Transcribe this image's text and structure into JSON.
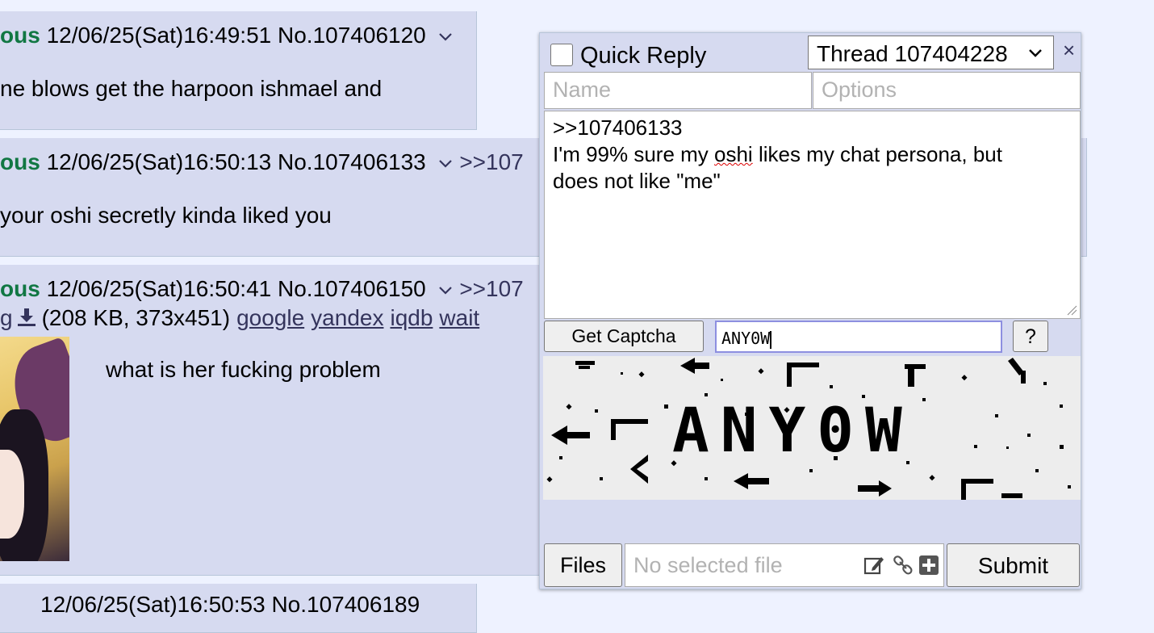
{
  "posts": [
    {
      "name": "ous",
      "datetime": "12/06/25(Sat)16:49:51",
      "number": "No.107406120",
      "backlink": "",
      "message": "ne blows get the harpoon ishmael and"
    },
    {
      "name": "ous",
      "datetime": "12/06/25(Sat)16:50:13",
      "number": "No.107406133",
      "backlink": ">>107",
      "message": "your oshi secretly kinda liked you"
    },
    {
      "name": "ous",
      "datetime": "12/06/25(Sat)16:50:41",
      "number": "No.107406150",
      "backlink": ">>107",
      "message": "what is her fucking problem",
      "file": {
        "name_tail": "g",
        "size": "(208 KB, 373x451)",
        "links": [
          "google",
          "yandex",
          "iqdb",
          "wait"
        ]
      }
    },
    {
      "partial": "12/06/25(Sat)16:50:53 No.107406189"
    }
  ],
  "quick_reply": {
    "title": "Quick Reply",
    "thread_select": "Thread 107404228",
    "close": "×",
    "name_placeholder": "Name",
    "options_placeholder": "Options",
    "comment": {
      "line1": ">>107406133",
      "line2_pre": "I'm 99% sure my ",
      "line2_misspelled": "oshi",
      "line2_post": " likes my chat persona, but",
      "line3": "does not like \"me\""
    },
    "get_captcha": "Get Captcha",
    "captcha_value": "ANY0W",
    "captcha_help": "?",
    "captcha_text": "ANY0W",
    "files_button": "Files",
    "file_placeholder": "No selected file",
    "submit": "Submit"
  },
  "icons": [
    "chevron-down-icon",
    "download-icon",
    "close-icon",
    "resize-grip-icon",
    "edit-icon",
    "link-icon",
    "add-icon"
  ],
  "colors": {
    "post_bg": "#d6daf0",
    "page_bg": "#eef2ff",
    "poster_name": "#117743",
    "link": "#34345c"
  }
}
